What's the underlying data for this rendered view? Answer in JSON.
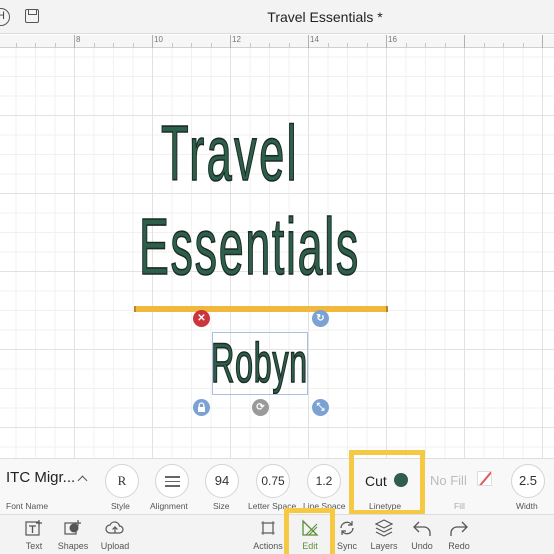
{
  "titlebar": {
    "left_letter": "H",
    "title": "Travel Essentials *"
  },
  "ruler": {
    "labels": [
      "8",
      "10",
      "12",
      "14",
      "16"
    ]
  },
  "design": {
    "line1": "Travel",
    "line2": "Essentials",
    "name": "Robyn",
    "text_color": "#2d5f4b",
    "accent_color": "#f0b93e"
  },
  "properties": {
    "font_name": {
      "value": "ITC Migr...",
      "label": "Font Name"
    },
    "style": {
      "value": "R",
      "label": "Style"
    },
    "alignment": {
      "label": "Alignment"
    },
    "size": {
      "value": "94",
      "label": "Size"
    },
    "letter_space": {
      "value": "0.75",
      "label": "Letter Space"
    },
    "line_space": {
      "value": "1.2",
      "label": "Line Space"
    },
    "linetype": {
      "value": "Cut",
      "label": "Linetype",
      "color": "#2d5f4b"
    },
    "fill": {
      "value": "No Fill",
      "label": "Fill"
    },
    "width": {
      "value": "2.5",
      "label": "Width"
    }
  },
  "bottombar": {
    "items": [
      {
        "label": "Text",
        "icon": "text-icon"
      },
      {
        "label": "Shapes",
        "icon": "shapes-icon"
      },
      {
        "label": "Upload",
        "icon": "upload-icon"
      },
      {
        "label": "Actions",
        "icon": "actions-icon"
      },
      {
        "label": "Edit",
        "icon": "edit-icon"
      },
      {
        "label": "Sync",
        "icon": "sync-icon"
      },
      {
        "label": "Layers",
        "icon": "layers-icon"
      },
      {
        "label": "Undo",
        "icon": "undo-icon"
      },
      {
        "label": "Redo",
        "icon": "redo-icon"
      }
    ]
  },
  "highlight_color": "#f6c944"
}
